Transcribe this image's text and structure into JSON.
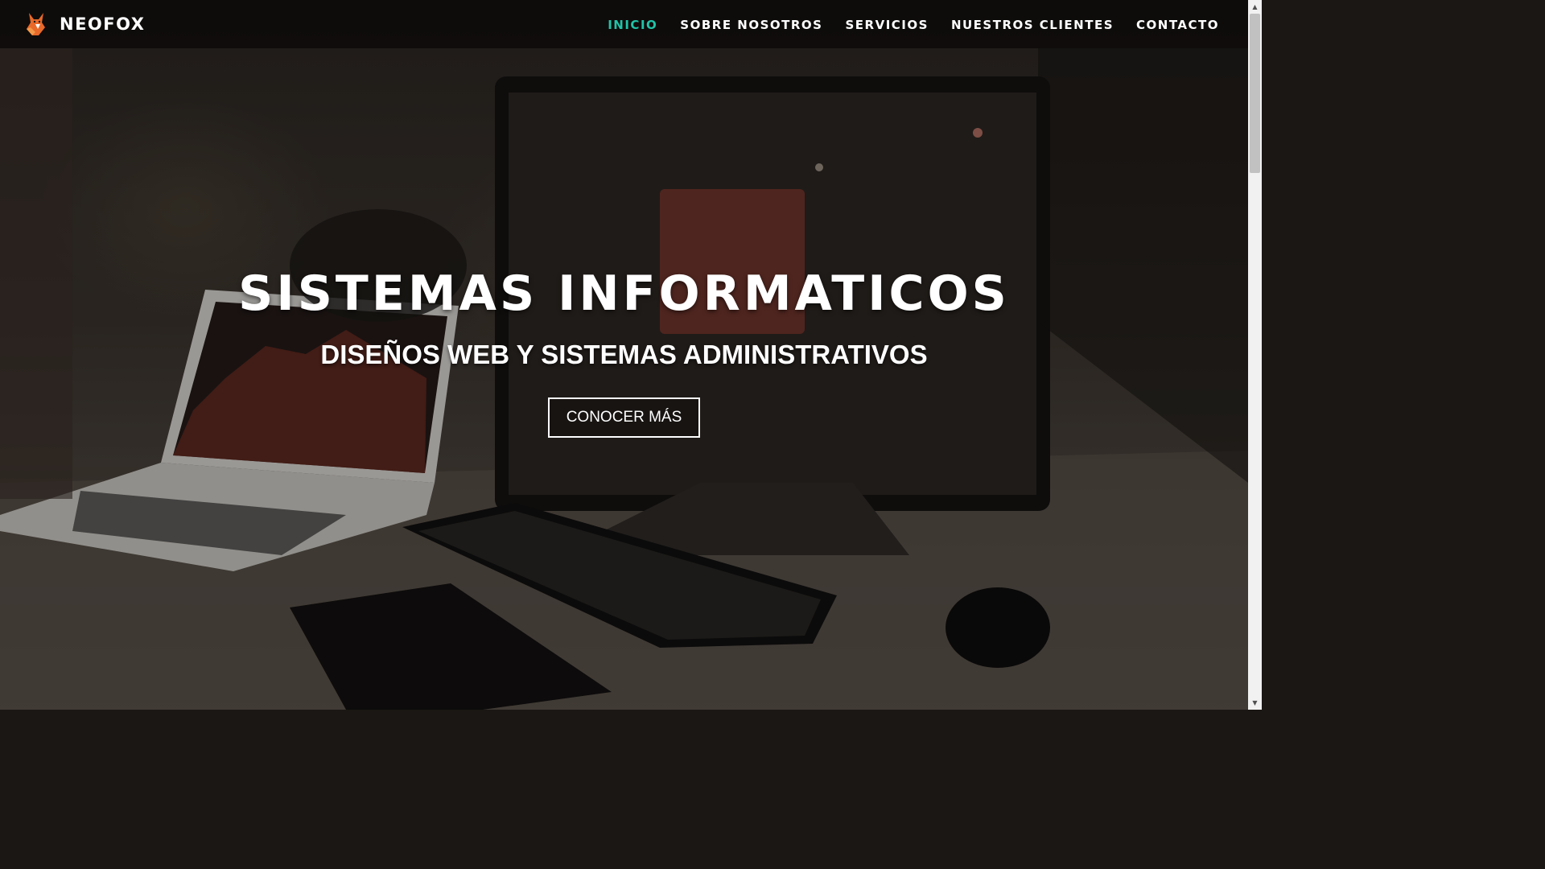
{
  "brand": {
    "name": "NEOFOX",
    "logo_icon": "fox-icon"
  },
  "nav": {
    "items": [
      {
        "label": "INICIO",
        "active": true
      },
      {
        "label": "SOBRE NOSOTROS",
        "active": false
      },
      {
        "label": "SERVICIOS",
        "active": false
      },
      {
        "label": "NUESTROS CLIENTES",
        "active": false
      },
      {
        "label": "CONTACTO",
        "active": false
      }
    ]
  },
  "hero": {
    "title": "SISTEMAS INFORMATICOS",
    "subtitle": "DISEÑOS WEB Y SISTEMAS ADMINISTRATIVOS",
    "button_label": "CONOCER MÁS",
    "background_image": "desk-with-laptop-and-monitor-photo"
  },
  "colors": {
    "accent": "#20c4a8",
    "text": "#ffffff",
    "navbar_bg": "#0c0a09"
  }
}
